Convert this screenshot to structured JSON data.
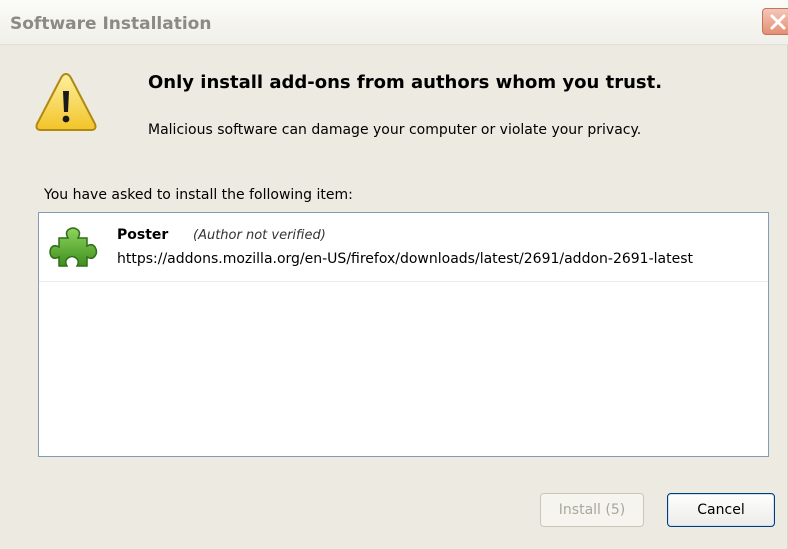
{
  "window": {
    "title": "Software Installation"
  },
  "warning": {
    "headline": "Only install add-ons from authors whom you trust.",
    "detail": "Malicious software can damage your computer or violate your privacy."
  },
  "list": {
    "label": "You have asked to install the following item:",
    "items": [
      {
        "name": "Poster",
        "status": "(Author not verified)",
        "url": "https://addons.mozilla.org/en-US/firefox/downloads/latest/2691/addon-2691-latest"
      }
    ]
  },
  "buttons": {
    "install_label": "Install (5)",
    "install_enabled": false,
    "cancel_label": "Cancel"
  },
  "icons": {
    "warning": "warning-triangle-icon",
    "addon": "puzzle-piece-icon",
    "close": "close-icon"
  },
  "colors": {
    "dialog_background": "#eceae1",
    "warning_yellow": "#f6d24a",
    "addon_green": "#5bb133",
    "cancel_border": "#003c74"
  }
}
